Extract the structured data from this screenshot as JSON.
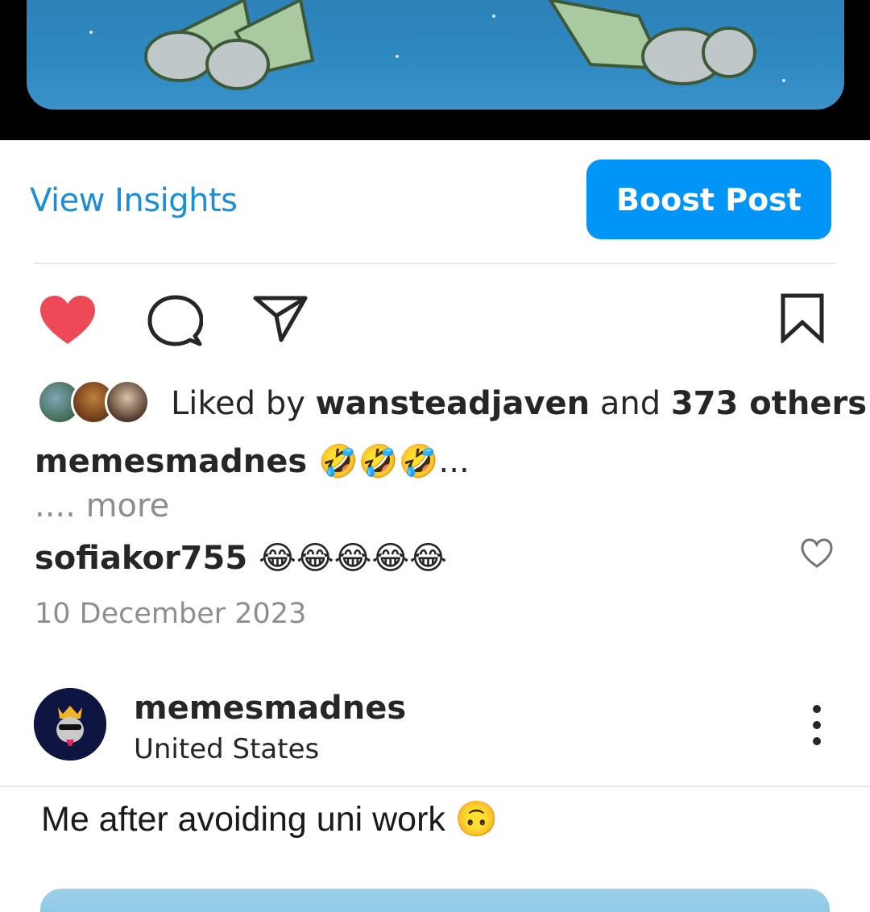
{
  "insights": {
    "view_label": "View Insights",
    "boost_label": "Boost Post"
  },
  "actions": {
    "like_icon": "heart-filled-icon",
    "comment_icon": "comment-icon",
    "share_icon": "paper-plane-icon",
    "save_icon": "bookmark-icon",
    "like_color": "#ed4956"
  },
  "likes": {
    "prefix": "Liked by",
    "user": "wansteadjaven",
    "connector": "and",
    "others": "373 others"
  },
  "caption": {
    "username": "memesmadnes",
    "emojis": "🤣🤣🤣...",
    "more": ".... more"
  },
  "top_comment": {
    "username": "sofiakor755",
    "emojis": "😂😂😂😂😂"
  },
  "date": "10 December 2023",
  "next_post": {
    "username": "memesmadnes",
    "location": "United States",
    "caption": "Me after avoiding uni work 🙃"
  },
  "colors": {
    "accent": "#0095f6",
    "link": "#1a8fd8",
    "muted": "#8e8e8e"
  }
}
